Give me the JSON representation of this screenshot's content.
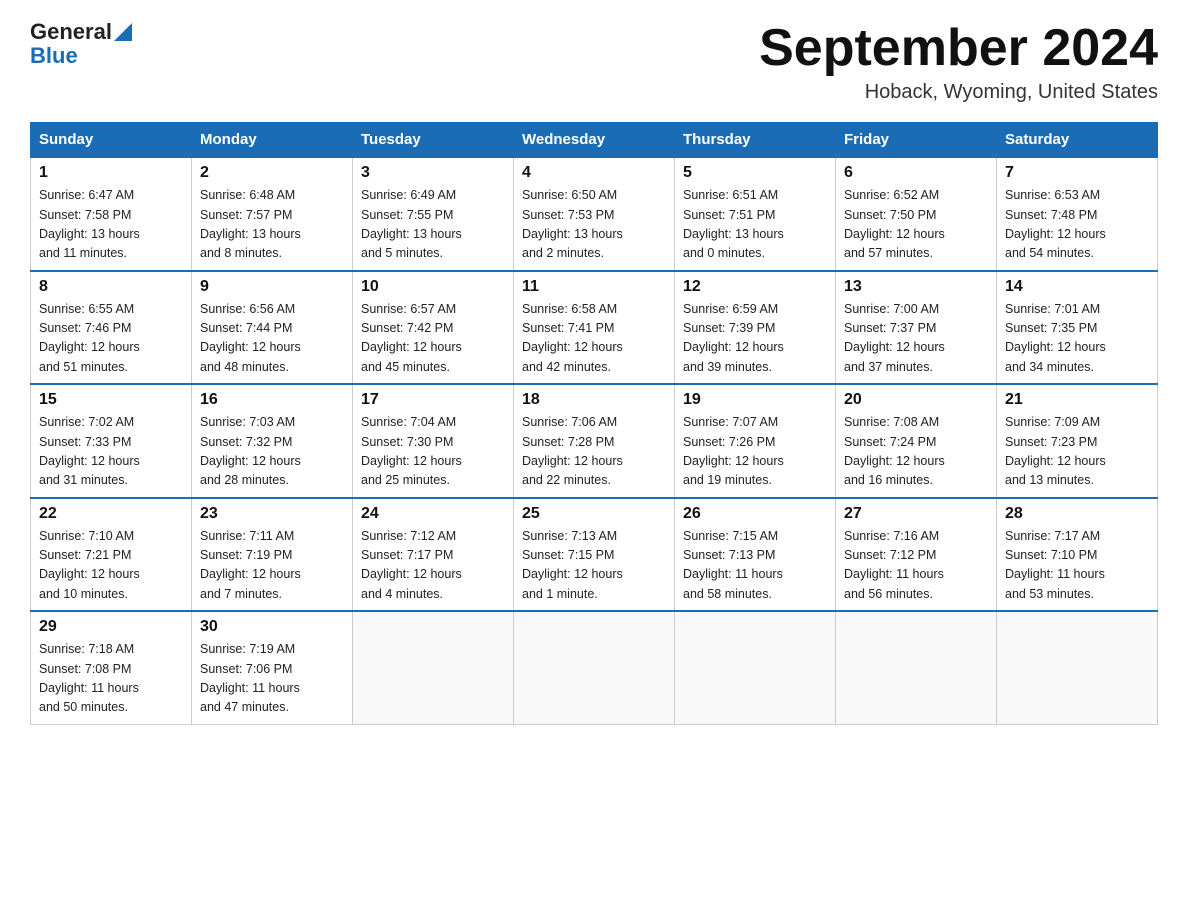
{
  "logo": {
    "general": "General",
    "blue": "Blue"
  },
  "title": "September 2024",
  "subtitle": "Hoback, Wyoming, United States",
  "weekdays": [
    "Sunday",
    "Monday",
    "Tuesday",
    "Wednesday",
    "Thursday",
    "Friday",
    "Saturday"
  ],
  "weeks": [
    [
      {
        "day": "1",
        "info": "Sunrise: 6:47 AM\nSunset: 7:58 PM\nDaylight: 13 hours\nand 11 minutes."
      },
      {
        "day": "2",
        "info": "Sunrise: 6:48 AM\nSunset: 7:57 PM\nDaylight: 13 hours\nand 8 minutes."
      },
      {
        "day": "3",
        "info": "Sunrise: 6:49 AM\nSunset: 7:55 PM\nDaylight: 13 hours\nand 5 minutes."
      },
      {
        "day": "4",
        "info": "Sunrise: 6:50 AM\nSunset: 7:53 PM\nDaylight: 13 hours\nand 2 minutes."
      },
      {
        "day": "5",
        "info": "Sunrise: 6:51 AM\nSunset: 7:51 PM\nDaylight: 13 hours\nand 0 minutes."
      },
      {
        "day": "6",
        "info": "Sunrise: 6:52 AM\nSunset: 7:50 PM\nDaylight: 12 hours\nand 57 minutes."
      },
      {
        "day": "7",
        "info": "Sunrise: 6:53 AM\nSunset: 7:48 PM\nDaylight: 12 hours\nand 54 minutes."
      }
    ],
    [
      {
        "day": "8",
        "info": "Sunrise: 6:55 AM\nSunset: 7:46 PM\nDaylight: 12 hours\nand 51 minutes."
      },
      {
        "day": "9",
        "info": "Sunrise: 6:56 AM\nSunset: 7:44 PM\nDaylight: 12 hours\nand 48 minutes."
      },
      {
        "day": "10",
        "info": "Sunrise: 6:57 AM\nSunset: 7:42 PM\nDaylight: 12 hours\nand 45 minutes."
      },
      {
        "day": "11",
        "info": "Sunrise: 6:58 AM\nSunset: 7:41 PM\nDaylight: 12 hours\nand 42 minutes."
      },
      {
        "day": "12",
        "info": "Sunrise: 6:59 AM\nSunset: 7:39 PM\nDaylight: 12 hours\nand 39 minutes."
      },
      {
        "day": "13",
        "info": "Sunrise: 7:00 AM\nSunset: 7:37 PM\nDaylight: 12 hours\nand 37 minutes."
      },
      {
        "day": "14",
        "info": "Sunrise: 7:01 AM\nSunset: 7:35 PM\nDaylight: 12 hours\nand 34 minutes."
      }
    ],
    [
      {
        "day": "15",
        "info": "Sunrise: 7:02 AM\nSunset: 7:33 PM\nDaylight: 12 hours\nand 31 minutes."
      },
      {
        "day": "16",
        "info": "Sunrise: 7:03 AM\nSunset: 7:32 PM\nDaylight: 12 hours\nand 28 minutes."
      },
      {
        "day": "17",
        "info": "Sunrise: 7:04 AM\nSunset: 7:30 PM\nDaylight: 12 hours\nand 25 minutes."
      },
      {
        "day": "18",
        "info": "Sunrise: 7:06 AM\nSunset: 7:28 PM\nDaylight: 12 hours\nand 22 minutes."
      },
      {
        "day": "19",
        "info": "Sunrise: 7:07 AM\nSunset: 7:26 PM\nDaylight: 12 hours\nand 19 minutes."
      },
      {
        "day": "20",
        "info": "Sunrise: 7:08 AM\nSunset: 7:24 PM\nDaylight: 12 hours\nand 16 minutes."
      },
      {
        "day": "21",
        "info": "Sunrise: 7:09 AM\nSunset: 7:23 PM\nDaylight: 12 hours\nand 13 minutes."
      }
    ],
    [
      {
        "day": "22",
        "info": "Sunrise: 7:10 AM\nSunset: 7:21 PM\nDaylight: 12 hours\nand 10 minutes."
      },
      {
        "day": "23",
        "info": "Sunrise: 7:11 AM\nSunset: 7:19 PM\nDaylight: 12 hours\nand 7 minutes."
      },
      {
        "day": "24",
        "info": "Sunrise: 7:12 AM\nSunset: 7:17 PM\nDaylight: 12 hours\nand 4 minutes."
      },
      {
        "day": "25",
        "info": "Sunrise: 7:13 AM\nSunset: 7:15 PM\nDaylight: 12 hours\nand 1 minute."
      },
      {
        "day": "26",
        "info": "Sunrise: 7:15 AM\nSunset: 7:13 PM\nDaylight: 11 hours\nand 58 minutes."
      },
      {
        "day": "27",
        "info": "Sunrise: 7:16 AM\nSunset: 7:12 PM\nDaylight: 11 hours\nand 56 minutes."
      },
      {
        "day": "28",
        "info": "Sunrise: 7:17 AM\nSunset: 7:10 PM\nDaylight: 11 hours\nand 53 minutes."
      }
    ],
    [
      {
        "day": "29",
        "info": "Sunrise: 7:18 AM\nSunset: 7:08 PM\nDaylight: 11 hours\nand 50 minutes."
      },
      {
        "day": "30",
        "info": "Sunrise: 7:19 AM\nSunset: 7:06 PM\nDaylight: 11 hours\nand 47 minutes."
      },
      {
        "day": "",
        "info": ""
      },
      {
        "day": "",
        "info": ""
      },
      {
        "day": "",
        "info": ""
      },
      {
        "day": "",
        "info": ""
      },
      {
        "day": "",
        "info": ""
      }
    ]
  ]
}
